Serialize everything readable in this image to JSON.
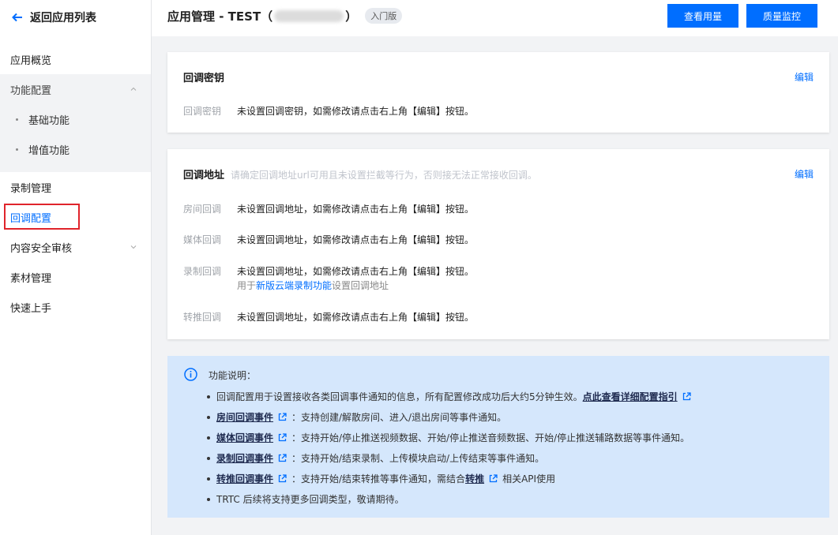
{
  "sidebar": {
    "back_label": "返回应用列表",
    "items": [
      {
        "label": "应用概览"
      },
      {
        "label": "功能配置"
      },
      {
        "label": "基础功能"
      },
      {
        "label": "增值功能"
      },
      {
        "label": "录制管理"
      },
      {
        "label": "回调配置"
      },
      {
        "label": "内容安全审核"
      },
      {
        "label": "素材管理"
      },
      {
        "label": "快速上手"
      }
    ]
  },
  "header": {
    "title_prefix": "应用管理 - TEST（",
    "title_suffix": "）",
    "badge": "入门版",
    "btn_usage": "查看用量",
    "btn_quality": "质量监控"
  },
  "key_card": {
    "title": "回调密钥",
    "edit": "编辑",
    "label": "回调密钥",
    "value": "未设置回调密钥，如需修改请点击右上角【编辑】按钮。"
  },
  "addr_card": {
    "title": "回调地址",
    "hint": "请确定回调地址url可用且未设置拦截等行为，否则接无法正常接收回调。",
    "edit": "编辑",
    "rows": [
      {
        "label": "房间回调",
        "value": "未设置回调地址，如需修改请点击右上角【编辑】按钮。"
      },
      {
        "label": "媒体回调",
        "value": "未设置回调地址，如需修改请点击右上角【编辑】按钮。"
      },
      {
        "label": "录制回调",
        "value": "未设置回调地址，如需修改请点击右上角【编辑】按钮。"
      },
      {
        "label": "转推回调",
        "value": "未设置回调地址，如需修改请点击右上角【编辑】按钮。"
      }
    ],
    "record_sub_prefix": "用于",
    "record_sub_link": "新版云端录制功能",
    "record_sub_suffix": "设置回调地址"
  },
  "info": {
    "heading": "功能说明：",
    "line1_text": "回调配置用于设置接收各类回调事件通知的信息，所有配置修改成功后大约5分钟生效。",
    "line1_link": "点此查看详细配置指引",
    "line2_link": "房间回调事件",
    "line2_text": "：支持创建/解散房间、进入/退出房间等事件通知。",
    "line3_link": "媒体回调事件",
    "line3_text": "：支持开始/停止推送视频数据、开始/停止推送音频数据、开始/停止推送辅路数据等事件通知。",
    "line4_link": "录制回调事件",
    "line4_text": "：支持开始/结束录制、上传模块启动/上传结束等事件通知。",
    "line5_link": "转推回调事件",
    "line5_text": "：支持开始/结束转推等事件通知，需结合",
    "line5_link2": "转推",
    "line5_tail": "相关API使用",
    "line6_text": "TRTC 后续将支持更多回调类型，敬请期待。"
  },
  "colors": {
    "accent": "#006eff",
    "highlight": "#e0242b",
    "info_bg": "#d5e7fc"
  }
}
